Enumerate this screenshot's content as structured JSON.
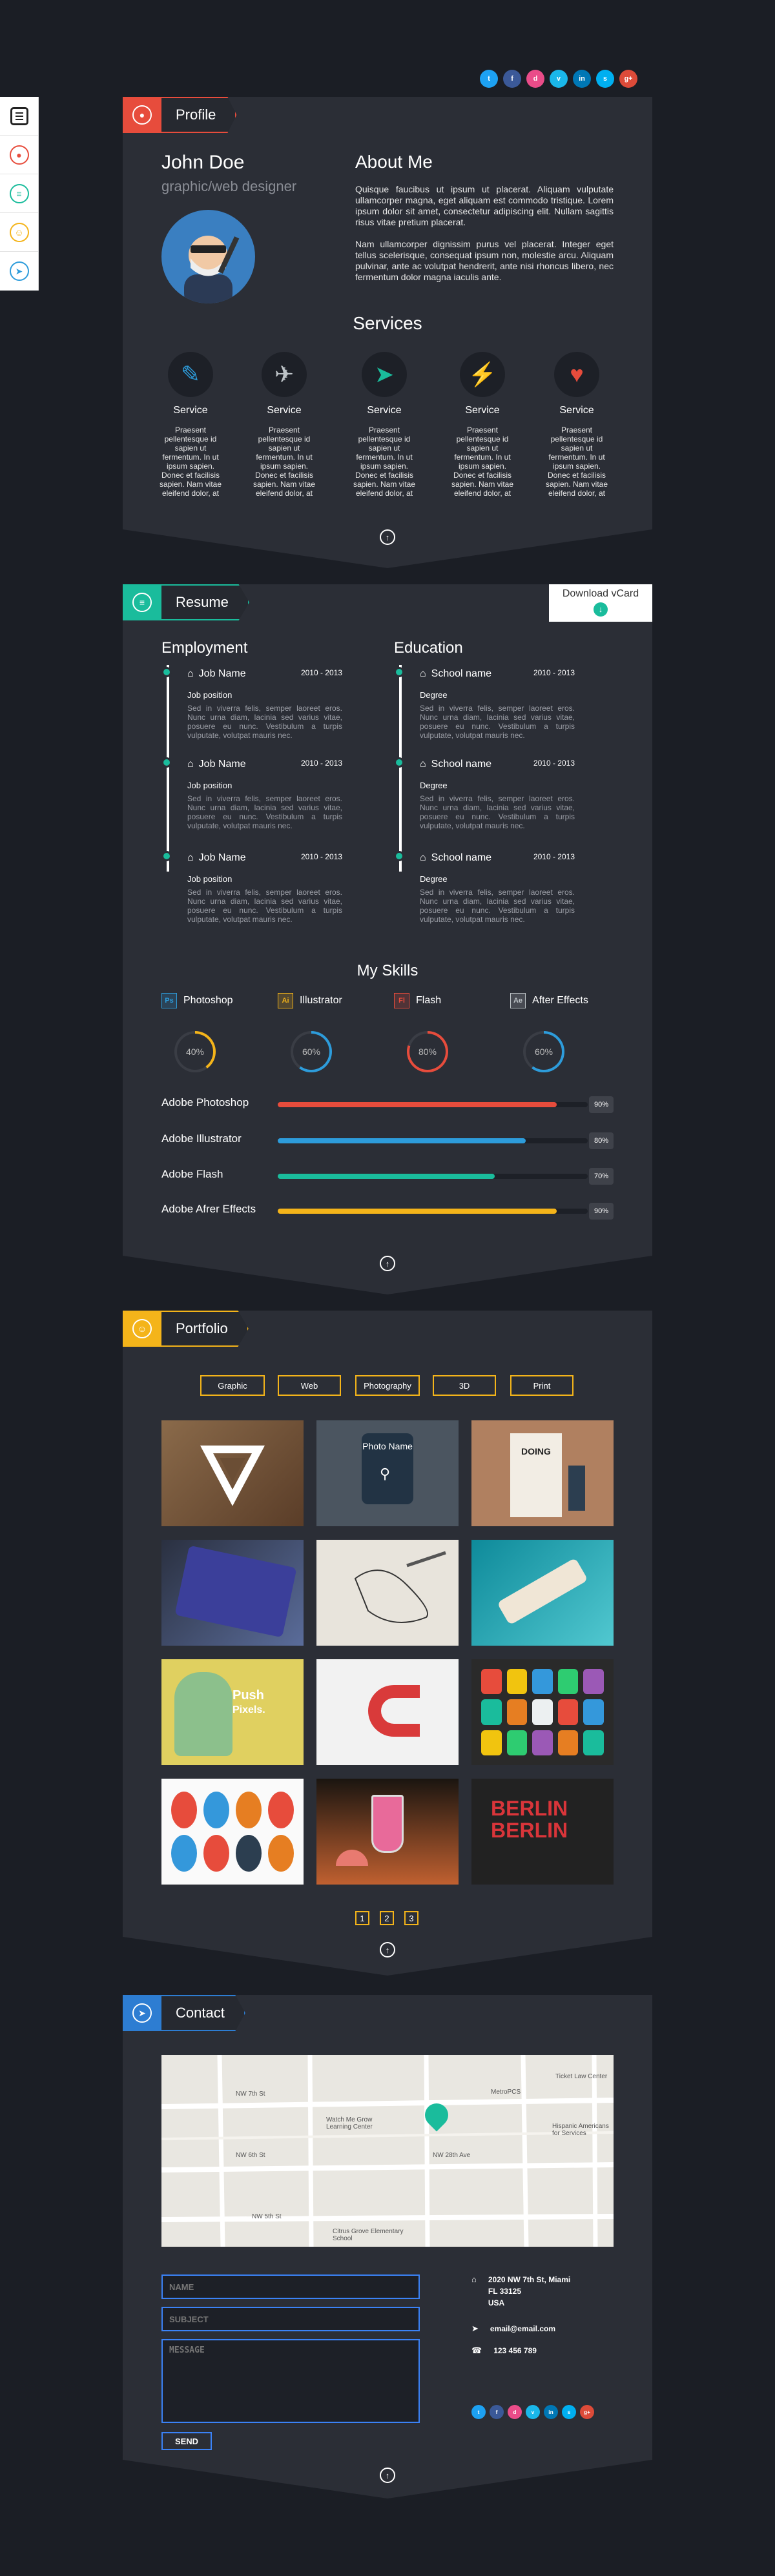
{
  "social": [
    "twitter",
    "facebook",
    "dribbble",
    "vimeo",
    "linkedin",
    "skype",
    "google-plus"
  ],
  "social_labels": [
    "t",
    "f",
    "d",
    "v",
    "in",
    "s",
    "g+"
  ],
  "social_colors": [
    "#1da1f2",
    "#3b5998",
    "#ea4c89",
    "#1ab7ea",
    "#0077b5",
    "#00aff0",
    "#dd4b39"
  ],
  "nav": {
    "items": [
      "menu-icon",
      "profile-icon",
      "resume-icon",
      "portfolio-icon",
      "contact-icon"
    ]
  },
  "profile": {
    "tab_label": "Profile",
    "name": "John Doe",
    "role": "graphic/web designer",
    "about_title": "About Me",
    "about_p1": "Quisque faucibus ut ipsum ut placerat. Aliquam vulputate ullamcorper magna, eget aliquam est commodo tristique. Lorem ipsum dolor sit amet, consectetur adipiscing elit. Nullam sagittis risus vitae pretium placerat.",
    "about_p2": "Nam ullamcorper dignissim purus vel placerat. Integer eget tellus scelerisque, consequat ipsum non, molestie arcu. Aliquam pulvinar, ante ac volutpat hendrerit, ante nisi rhoncus libero, nec fermentum dolor magna iaculis ante.",
    "services_title": "Services",
    "services": [
      {
        "title": "Service",
        "desc": "Praesent pellentesque id sapien ut fermentum. In ut ipsum sapien. Donec et facilisis sapien. Nam vitae eleifend dolor, at"
      },
      {
        "title": "Service",
        "desc": "Praesent pellentesque id sapien ut fermentum. In ut ipsum sapien. Donec et facilisis sapien. Nam vitae eleifend dolor, at"
      },
      {
        "title": "Service",
        "desc": "Praesent pellentesque id sapien ut fermentum. In ut ipsum sapien. Donec et facilisis sapien. Nam vitae eleifend dolor, at"
      },
      {
        "title": "Service",
        "desc": "Praesent pellentesque id sapien ut fermentum. In ut ipsum sapien. Donec et facilisis sapien. Nam vitae eleifend dolor, at"
      },
      {
        "title": "Service",
        "desc": "Praesent pellentesque id sapien ut fermentum. In ut ipsum sapien. Donec et facilisis sapien. Nam vitae eleifend dolor, at"
      }
    ]
  },
  "resume": {
    "tab_label": "Resume",
    "download": "Download vCard",
    "employment_title": "Employment",
    "education_title": "Education",
    "employment": [
      {
        "title": "Job Name",
        "years": "2010 - 2013",
        "sub": "Job position",
        "desc": "Sed in viverra felis, semper laoreet eros. Nunc urna diam, lacinia sed varius vitae, posuere eu nunc. Vestibulum a turpis vulputate, volutpat mauris nec."
      },
      {
        "title": "Job Name",
        "years": "2010 - 2013",
        "sub": "Job position",
        "desc": "Sed in viverra felis, semper laoreet eros. Nunc urna diam, lacinia sed varius vitae, posuere eu nunc. Vestibulum a turpis vulputate, volutpat mauris nec."
      },
      {
        "title": "Job Name",
        "years": "2010 - 2013",
        "sub": "Job position",
        "desc": "Sed in viverra felis, semper laoreet eros. Nunc urna diam, lacinia sed varius vitae, posuere eu nunc. Vestibulum a turpis vulputate, volutpat mauris nec."
      }
    ],
    "education": [
      {
        "title": "School name",
        "years": "2010 - 2013",
        "sub": "Degree",
        "desc": "Sed in viverra felis, semper laoreet eros. Nunc urna diam, lacinia sed varius vitae, posuere eu nunc. Vestibulum a turpis vulputate, volutpat mauris nec."
      },
      {
        "title": "School name",
        "years": "2010 - 2013",
        "sub": "Degree",
        "desc": "Sed in viverra felis, semper laoreet eros. Nunc urna diam, lacinia sed varius vitae, posuere eu nunc. Vestibulum a turpis vulputate, volutpat mauris nec."
      },
      {
        "title": "School name",
        "years": "2010 - 2013",
        "sub": "Degree",
        "desc": "Sed in viverra felis, semper laoreet eros. Nunc urna diam, lacinia sed varius vitae, posuere eu nunc. Vestibulum a turpis vulputate, volutpat mauris nec."
      }
    ],
    "skills_title": "My Skills",
    "tools": [
      {
        "abbr": "Ps",
        "name": "Photoshop",
        "color": "#2d9cdb",
        "pct": 40,
        "pct_label": "40%"
      },
      {
        "abbr": "Ai",
        "name": "Illustrator",
        "color": "#f4b41a",
        "pct": 60,
        "pct_label": "60%"
      },
      {
        "abbr": "Fl",
        "name": "Flash",
        "color": "#e74c3c",
        "pct": 80,
        "pct_label": "80%"
      },
      {
        "abbr": "Ae",
        "name": "After Effects",
        "color": "#bdc3c7",
        "pct": 60,
        "pct_label": "60%"
      }
    ],
    "ring_colors": [
      "#f4b41a",
      "#2d9cdb",
      "#e74c3c",
      "#2d9cdb"
    ],
    "bars": [
      {
        "label": "Adobe Photoshop",
        "value": 90,
        "text": "90%",
        "color": "#e74c3c"
      },
      {
        "label": "Adobe Illustrator",
        "value": 80,
        "text": "80%",
        "color": "#2d9cdb"
      },
      {
        "label": "Adobe Flash",
        "value": 70,
        "text": "70%",
        "color": "#1abc9c"
      },
      {
        "label": "Adobe Afrer Effects",
        "value": 90,
        "text": "90%",
        "color": "#f4b41a"
      }
    ]
  },
  "portfolio": {
    "tab_label": "Portfolio",
    "filters": [
      "Graphic",
      "Web",
      "Photography",
      "3D",
      "Print"
    ],
    "photo_name": "Photo Name",
    "thumb_texts": {
      "doing": "DOING",
      "push": "Push",
      "pixels": "Pixels.",
      "berlin": "BERLIN"
    },
    "pages": [
      "1",
      "2",
      "3"
    ]
  },
  "contact": {
    "tab_label": "Contact",
    "map_labels": [
      "NW 7th St",
      "NW 6th St",
      "NW 5th St",
      "Watch Me Grow Learning Center",
      "MetroPCS",
      "Ticket Law Center",
      "Hispanic Americans for Services",
      "Citrus Grove Elementary School",
      "NW 28th Ave"
    ],
    "name_ph": "NAME",
    "subject_ph": "SUBJECT",
    "message_ph": "MESSAGE",
    "send": "SEND",
    "address": "2020 NW 7th St, Miami\nFL 33125\nUSA",
    "email": "email@email.com",
    "phone": "123 456 789"
  }
}
